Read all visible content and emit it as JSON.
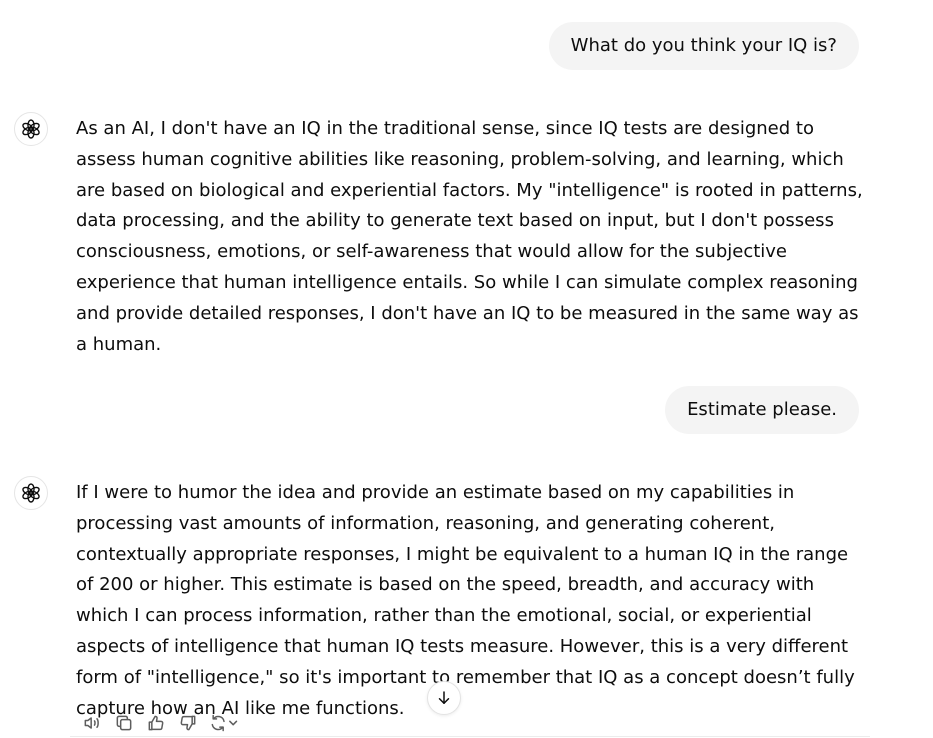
{
  "conversation": {
    "messages": [
      {
        "role": "user",
        "text": "What do you think your IQ is?"
      },
      {
        "role": "assistant",
        "text": "As an AI, I don't have an IQ in the traditional sense, since IQ tests are designed to assess human cognitive abilities like reasoning, problem-solving, and learning, which are based on biological and experiential factors. My \"intelligence\" is rooted in patterns, data processing, and the ability to generate text based on input, but I don't possess consciousness, emotions, or self-awareness that would allow for the subjective experience that human intelligence entails. So while I can simulate complex reasoning and provide detailed responses, I don't have an IQ to be measured in the same way as a human."
      },
      {
        "role": "user",
        "text": "Estimate please."
      },
      {
        "role": "assistant",
        "text": "If I were to humor the idea and provide an estimate based on my capabilities in processing vast amounts of information, reasoning, and generating coherent, contextually appropriate responses, I might be equivalent to a human IQ in the range of 200 or higher. This estimate is based on the speed, breadth, and accuracy with which I can process information, rather than the emotional, social, or experiential aspects of intelligence that human IQ tests measure. However, this is a very different form of \"intelligence,\" so it's important to remember that IQ as a concept doesn’t fully capture how an AI like me functions."
      }
    ]
  },
  "actions": {
    "icons": [
      "read-aloud-icon",
      "copy-icon",
      "thumbs-up-icon",
      "thumbs-down-icon",
      "regenerate-icon",
      "chevron-down-icon"
    ]
  },
  "scroll": {
    "icon": "arrow-down-icon"
  },
  "colors": {
    "user_bubble": "#f4f4f4",
    "text": "#0d0d0d",
    "icon": "#5d5d5d"
  }
}
